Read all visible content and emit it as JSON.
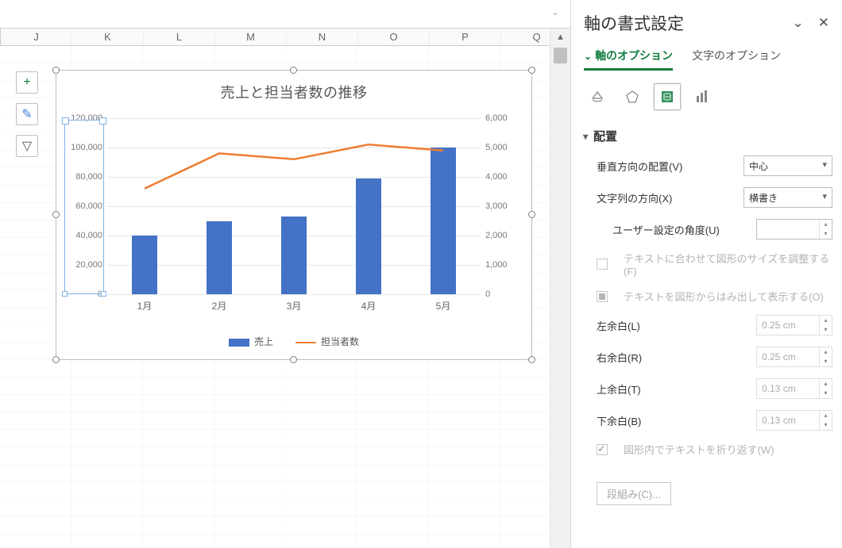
{
  "sheet": {
    "columns": [
      "J",
      "K",
      "L",
      "M",
      "N",
      "O",
      "P",
      "Q"
    ]
  },
  "float_tools": {
    "plus_glyph": "+",
    "brush_glyph": "✎",
    "funnel_glyph": "▽"
  },
  "chart": {
    "title": "売上と担当者数の推移",
    "legend": {
      "bar": "売上",
      "line": "担当者数"
    }
  },
  "chart_data": {
    "type": "bar+line",
    "categories": [
      "1月",
      "2月",
      "3月",
      "4月",
      "5月"
    ],
    "series": [
      {
        "name": "売上",
        "type": "bar",
        "axis": "left",
        "values": [
          40000,
          50000,
          53000,
          79000,
          100000
        ]
      },
      {
        "name": "担当者数",
        "type": "line",
        "axis": "right",
        "values": [
          3600,
          4800,
          4600,
          5100,
          4900
        ]
      }
    ],
    "y_left": {
      "min": 0,
      "max": 120000,
      "step": 20000,
      "ticks": [
        "0",
        "20,000",
        "40,000",
        "60,000",
        "80,000",
        "100,000",
        "120,000"
      ]
    },
    "y_right": {
      "min": 0,
      "max": 6000,
      "step": 1000,
      "ticks": [
        "0",
        "1,000",
        "2,000",
        "3,000",
        "4,000",
        "5,000",
        "6,000"
      ]
    },
    "title": "売上と担当者数の推移",
    "xlabel": "",
    "ylabel": "",
    "grid": true,
    "legend_position": "bottom"
  },
  "panel": {
    "title": "軸の書式設定",
    "tabs": {
      "options": "軸のオプション",
      "text": "文字のオプション"
    },
    "section": "配置",
    "valign_label": "垂直方向の配置(V)",
    "valign_value": "中心",
    "direction_label": "文字列の方向(X)",
    "direction_value": "横書き",
    "angle_label": "ユーザー設定の角度(U)",
    "angle_value": "",
    "resize_label": "テキストに合わせて図形のサイズを調整する(F)",
    "overflow_label": "テキストを図形からはみ出して表示する(O)",
    "margin_left_label": "左余白(L)",
    "margin_left_value": "0.25 cm",
    "margin_right_label": "右余白(R)",
    "margin_right_value": "0.25 cm",
    "margin_top_label": "上余白(T)",
    "margin_top_value": "0.13 cm",
    "margin_bottom_label": "下余白(B)",
    "margin_bottom_value": "0.13 cm",
    "wrap_label": "図形内でテキストを折り返す(W)",
    "columns_button": "段組み(C)..."
  },
  "colors": {
    "bar": "#4472C4",
    "line": "#ED7D31",
    "accent": "#107c41"
  }
}
